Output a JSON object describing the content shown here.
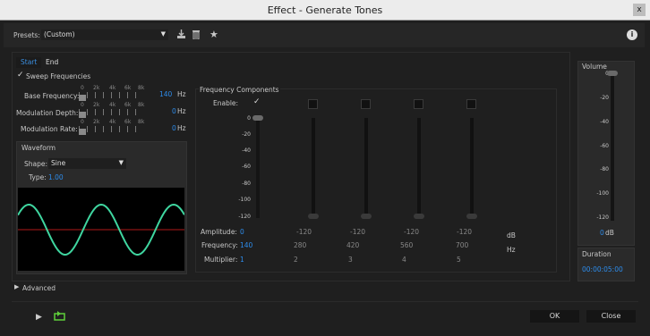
{
  "window": {
    "title": "Effect - Generate Tones",
    "close_label": "x"
  },
  "presets": {
    "label": "Presets:",
    "value": "(Custom)",
    "info": "i"
  },
  "tabs": [
    {
      "label": "Start"
    },
    {
      "label": "End"
    }
  ],
  "sweep": {
    "checked": true,
    "label": "Sweep Frequencies"
  },
  "sliders": {
    "ticks": [
      "0",
      "2k",
      "4k",
      "6k",
      "8k"
    ],
    "rows": [
      {
        "label": "Base Frequency:",
        "value": "140",
        "unit": "Hz"
      },
      {
        "label": "Modulation Depth:",
        "value": "0",
        "unit": "Hz"
      },
      {
        "label": "Modulation Rate:",
        "value": "0",
        "unit": "Hz"
      }
    ]
  },
  "waveform": {
    "title": "Waveform",
    "shape_label": "Shape:",
    "shape_value": "Sine",
    "type_label": "Type:",
    "type_value": "1.00",
    "wave_color": "#3fd6a0",
    "center_color": "#b11a1a"
  },
  "freq": {
    "title": "Frequency Components",
    "enable_label": "Enable:",
    "scale": [
      "0",
      "-20",
      "-40",
      "-60",
      "-80",
      "-100",
      "-120"
    ],
    "amplitude_label": "Amplitude:",
    "amplitudes": [
      "0",
      "-120",
      "-120",
      "-120",
      "-120"
    ],
    "amp_unit": "dB",
    "frequency_label": "Frequency:",
    "frequencies": [
      "140",
      "280",
      "420",
      "560",
      "700"
    ],
    "freq_unit": "Hz",
    "multiplier_label": "Multiplier:",
    "multipliers": [
      "1",
      "2",
      "3",
      "4",
      "5"
    ]
  },
  "volume": {
    "title": "Volume",
    "scale": [
      "0",
      "-20",
      "-40",
      "-60",
      "-80",
      "-100",
      "-120"
    ],
    "value": "0",
    "unit": "dB"
  },
  "duration": {
    "title": "Duration",
    "value": "00:00:05:00"
  },
  "advanced": {
    "label": "Advanced"
  },
  "buttons": {
    "ok": "OK",
    "close": "Close"
  }
}
